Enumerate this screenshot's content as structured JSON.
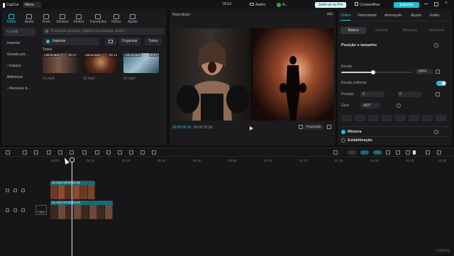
{
  "titlebar": {
    "app_name": "CapCut",
    "menu_label": "Menu",
    "project_name": "0514",
    "shortcuts_label": "Atalho",
    "user_label": "N...",
    "pro_label": "Junte-se ao Pro",
    "share_label": "Compartilhar",
    "export_label": "Exportar"
  },
  "toolbar": {
    "tools": [
      {
        "label": "Mídia",
        "icon": "media-icon"
      },
      {
        "label": "Áudio",
        "icon": "audio-icon"
      },
      {
        "label": "Texto",
        "icon": "text-icon"
      },
      {
        "label": "Stickers",
        "icon": "sticker-icon"
      },
      {
        "label": "Efeitos",
        "icon": "effects-icon"
      },
      {
        "label": "Transições",
        "icon": "transitions-icon"
      },
      {
        "label": "Filtros",
        "icon": "filters-icon"
      },
      {
        "label": "Ajuste",
        "icon": "adjust-icon"
      }
    ]
  },
  "sidebar": {
    "items": [
      "• Local",
      "Importar",
      "Gerado por...",
      "› Espaço",
      "Biblioteca",
      "› Recursos d..."
    ]
  },
  "media": {
    "search_placeholder": "Pesquisar projetos, objetos ou imagens, textos",
    "import_label": "Importar",
    "sort_label": "Organizar",
    "filter_label": "Todos",
    "section_label": "Todos",
    "clips": [
      {
        "added": "Adicionado",
        "duration": "00:17",
        "name": "01.mp4"
      },
      {
        "added": "Adicionado",
        "duration": "00:13",
        "name": "02.mp4"
      },
      {
        "added": "Adicionado",
        "duration": "00:07",
        "name": "03.mp4"
      }
    ]
  },
  "player": {
    "title": "Reprodutor",
    "time_current": "00:00:05:24",
    "time_total": "00:00:32:26",
    "ratio_label": "Proporção"
  },
  "inspector": {
    "tabs": [
      "Vídeo",
      "Velocidade",
      "Animação",
      "Ajuste",
      "Estilo"
    ],
    "subtabs": [
      "Básico",
      "Recorte",
      "Mascarar",
      "Aprimorar"
    ],
    "section_position": "Posição e tamanho",
    "scale_label": "Escala",
    "scale_value": "100%",
    "scale_fraction": 0.45,
    "uniform_scale_label": "Escala uniforme",
    "position_label": "Posição",
    "pos_x": "0",
    "pos_y": "0",
    "rotate_label": "Girar",
    "rotate_value": "-902°",
    "mix_label": "Mistura",
    "stabilize_label": "Estabilização"
  },
  "timeline": {
    "ruler_ticks": [
      "00:00",
      "00:10",
      "00:20",
      "00:30",
      "00:40",
      "00:50",
      "01:00",
      "01:10",
      "01:20",
      "01:30",
      "01:40",
      "01:50"
    ],
    "track_top_clip": {
      "name": "02.mp4",
      "duration": "00:00:12:05"
    },
    "track_main_clip": {
      "name": "01.mp4",
      "duration": "00:00:16:25"
    },
    "cover_label": "Capa"
  },
  "watermark": "Udemy",
  "colors": {
    "accent": "#22c2d9",
    "export": "#1fc2d6",
    "pro": "#d9f6f9"
  }
}
